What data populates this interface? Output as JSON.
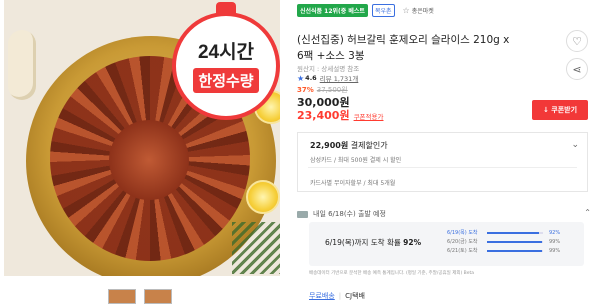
{
  "product_image": {
    "badge_line1": "24시간",
    "badge_line2": "한정수량"
  },
  "tags": {
    "green": "신선식품 12위(중 베스트",
    "blue": "목우촌",
    "store_icon": "star-outline-icon",
    "store": "총은마켓"
  },
  "title": "(신선집중) 허브갈릭 훈제오리 슬라이스 210g x 6팩 +소스 3봉",
  "origin": "원산지 : 상세설명 참조",
  "rating": {
    "score": "4.6",
    "reviews": "리뷰 1,731개"
  },
  "price": {
    "discount": "37%",
    "original": "37,500원",
    "regular": "30,000원",
    "sale": "23,400원",
    "coupon_note": "쿠폰적용가",
    "coupon_button": "↓ 쿠폰받기"
  },
  "card": {
    "price": "22,900원",
    "price_suffix": "결제할인가",
    "sub": "삼성카드 / 최대 500원 결제 시 할인",
    "installment": "카드사별 무이자할부 / 최대 5개월"
  },
  "delivery": {
    "head": "내일 6/18(수) 출발 예정",
    "main_prefix": "6/19(목)까지 도착 확률",
    "main_pct": "92%",
    "rows": [
      {
        "label": "6/19(목) 도착",
        "pct": "92%",
        "value": 0.92
      },
      {
        "label": "6/20(금) 도착",
        "pct": "99%",
        "value": 0.99
      },
      {
        "label": "6/21(토) 도착",
        "pct": "99%",
        "value": 0.99
      }
    ],
    "note": "배송데이터 기반으로 분석한 배송 예측 통계입니다. (평일 기준, 주말/공휴일 제외) Beta"
  },
  "footer": {
    "free_shipping": "무료배송",
    "courier": "CJ택배"
  },
  "colors": {
    "accent_red": "#f23838",
    "accent_blue": "#3a6fe0",
    "tag_green": "#22a74a"
  }
}
